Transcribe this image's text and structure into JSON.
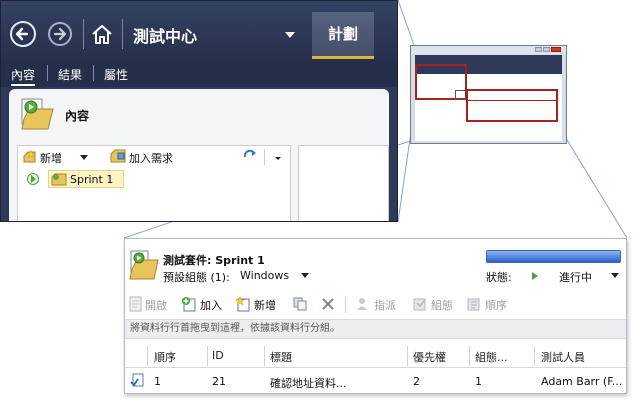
{
  "main_window": {
    "hub_title": "測試中心",
    "plan_tab": "計劃",
    "subtabs": [
      "內容",
      "結果",
      "屬性"
    ],
    "panel_title": "內容",
    "toolbar": {
      "new_label": "新增",
      "add_req_label": "加入需求"
    },
    "tree": {
      "node_label": "Sprint 1"
    }
  },
  "detail_window": {
    "suite_label": "測試套件: ",
    "suite_name": "Sprint 1",
    "config_label": "預設組態 (1):",
    "config_value": "Windows",
    "status_label": "狀態:",
    "status_value": "進行中",
    "progress_fraction": 1.0,
    "toolbar": {
      "open": "開啟",
      "add": "加入",
      "new": "新增",
      "assign": "指派",
      "configurations": "組態",
      "order": "順序"
    },
    "group_hint": "將資料行行首拖曳到這裡，依據該資料行分組。",
    "columns": [
      "順序",
      "ID",
      "標題",
      "優先權",
      "組態...",
      "測試人員"
    ],
    "rows": [
      {
        "order": "1",
        "id": "21",
        "title": "確認地址資料...",
        "priority": "2",
        "config": "1",
        "tester": "Adam Barr (F..."
      }
    ]
  },
  "colors": {
    "hub_bg": "#2f3a58",
    "plan_tab_underline": "#e0b33f",
    "highlight_red": "#a5231c",
    "progress_blue": "#2f62c9",
    "status_green": "#4ca43b"
  }
}
